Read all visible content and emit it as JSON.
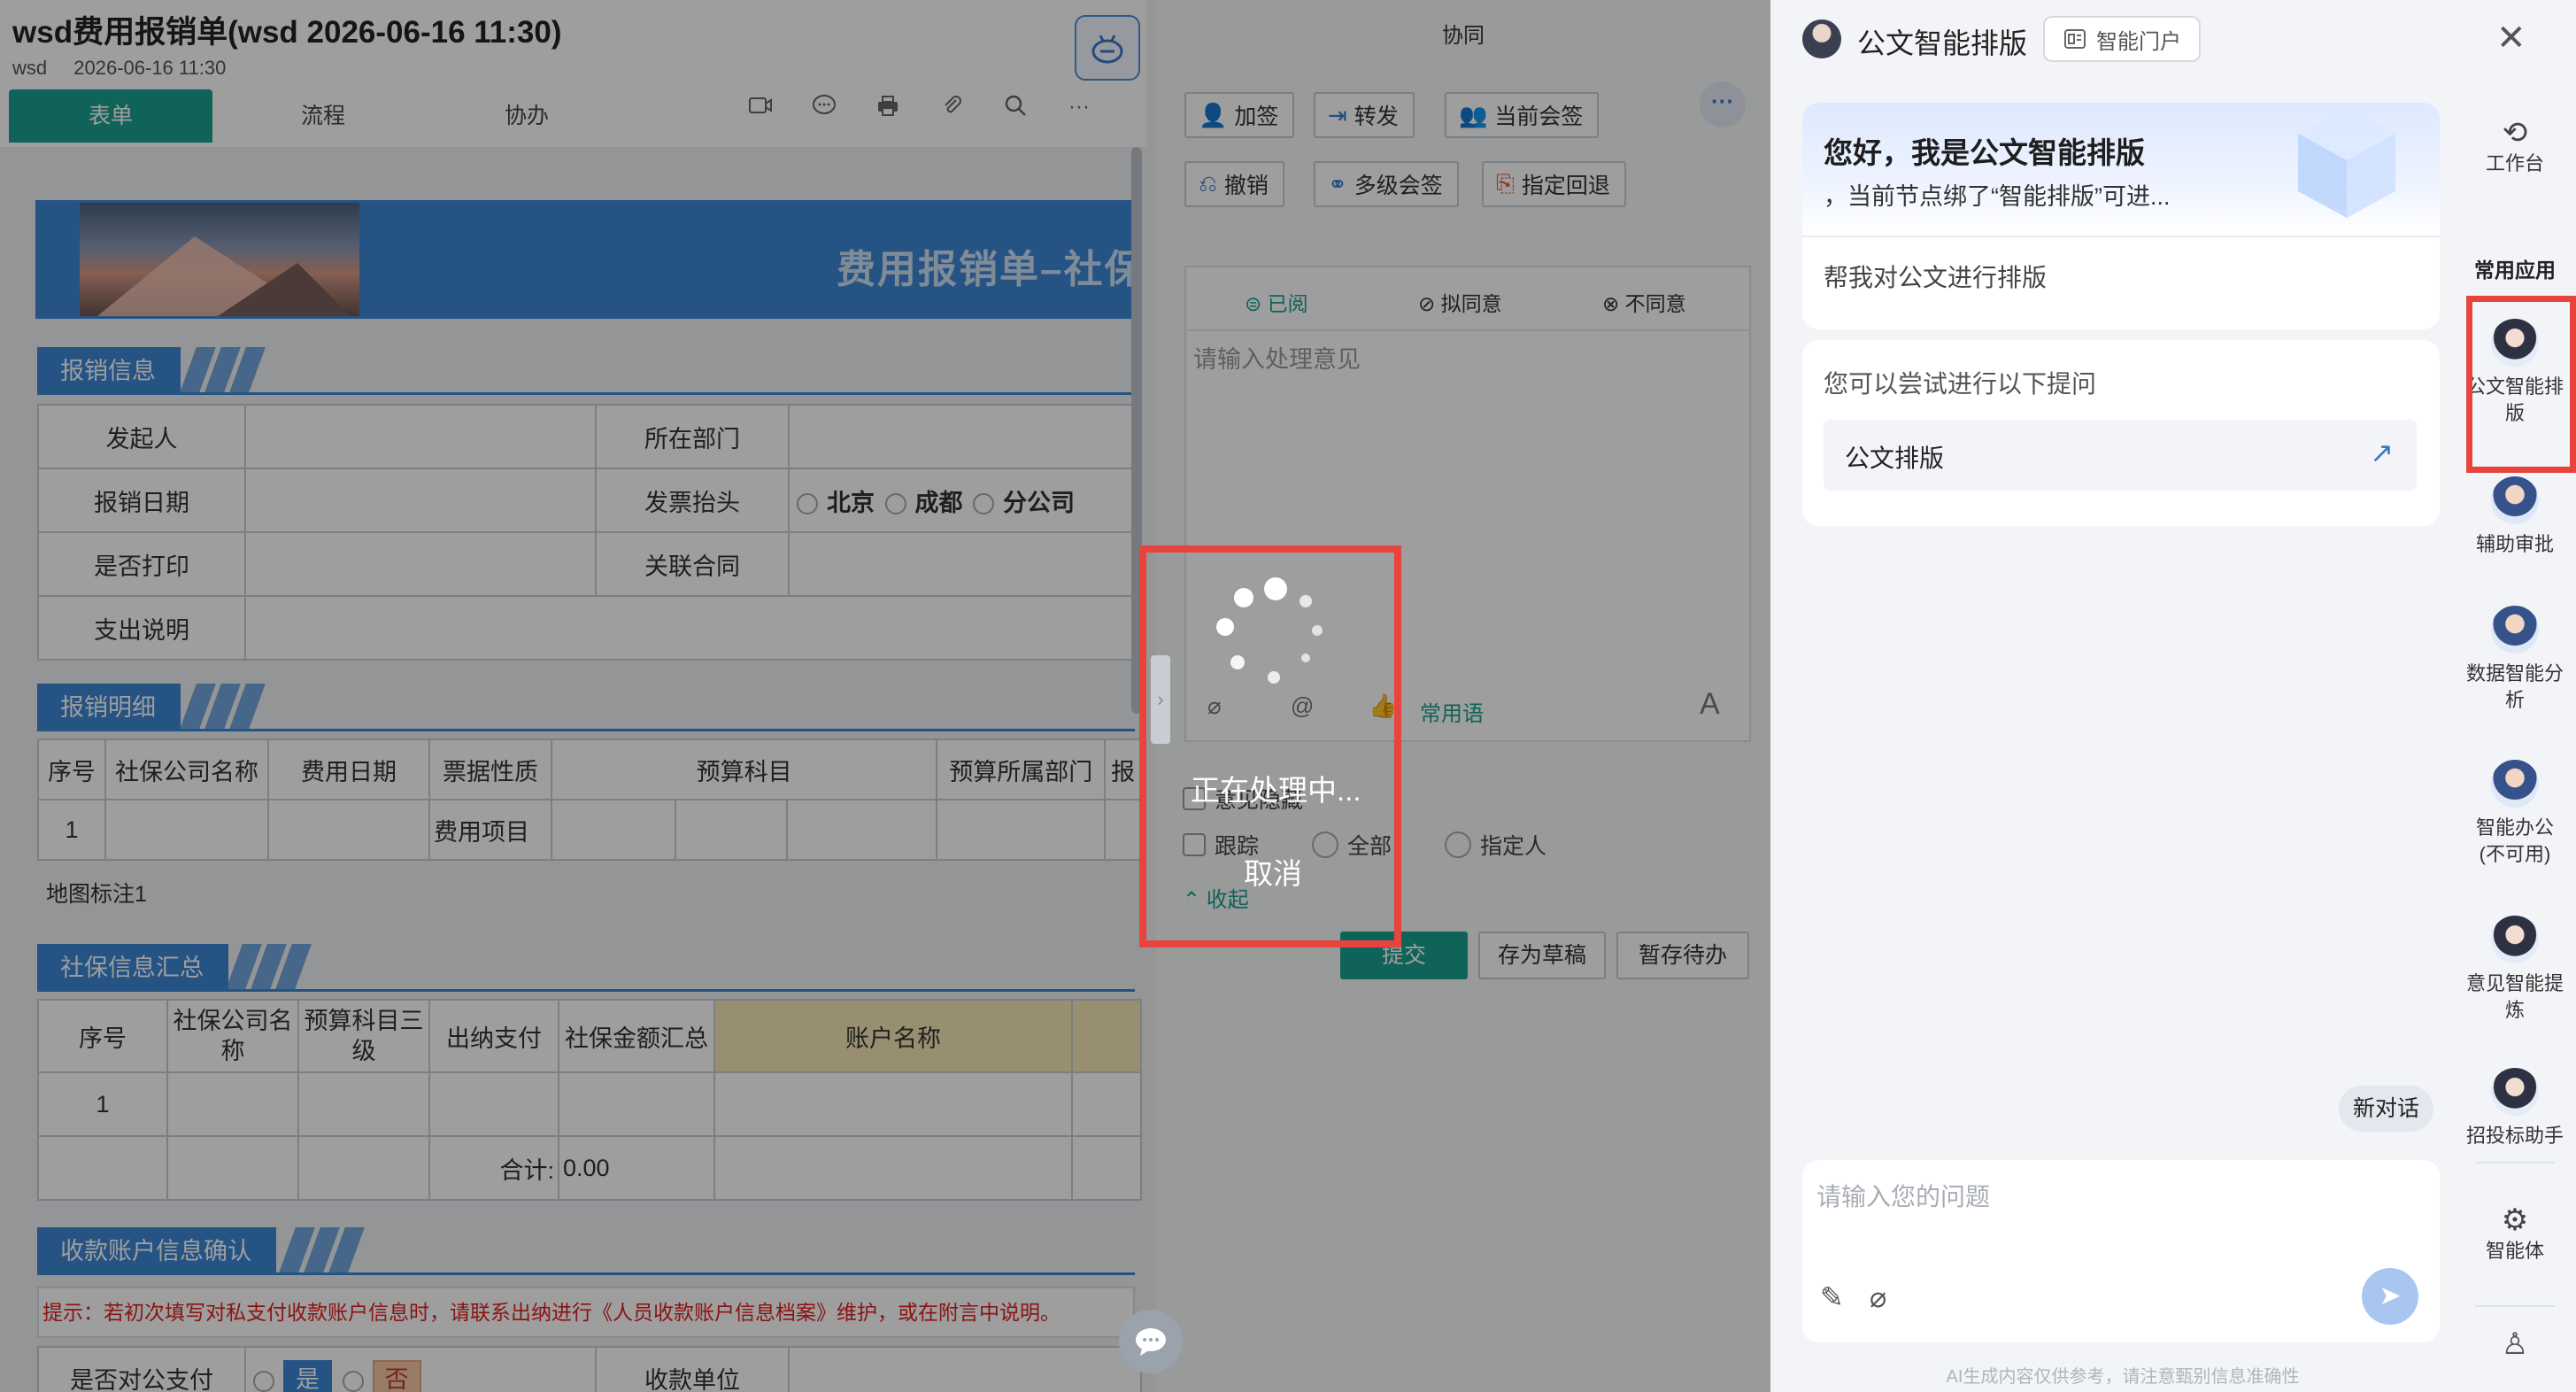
{
  "form": {
    "title": "wsd费用报销单(wsd 2026-06-16 11:30)",
    "meta_user": "wsd",
    "meta_time": "2026-06-16 11:30",
    "tabs": [
      "表单",
      "流程",
      "协办"
    ],
    "tool_icons": [
      "video-icon",
      "comment-icon",
      "print-icon",
      "attach-icon",
      "search-icon",
      "more-icon"
    ],
    "banner_title": "费用报销单–社保",
    "sec1": "报销信息",
    "sec2": "报销明细",
    "sec3": "社保信息汇总",
    "sec4": "收款账户信息确认",
    "info_rows": [
      [
        "发起人",
        "所在部门"
      ],
      [
        "报销日期",
        "发票抬头"
      ],
      [
        "是否打印",
        "关联合同"
      ],
      [
        "支出说明"
      ]
    ],
    "invoice_options": [
      "北京",
      "成都",
      "分公司"
    ],
    "detail_headers": [
      "序号",
      "社保公司名称",
      "费用日期",
      "票据性质",
      "预算科目",
      "预算所属部门",
      "报"
    ],
    "detail_row_no": "1",
    "detail_sub": "费用项目",
    "map_note": "地图标注1",
    "sum_headers": [
      "序号",
      "社保公司名称",
      "预算科目三级",
      "出纳支付",
      "社保金额汇总",
      "账户名称"
    ],
    "sum_row_no": "1",
    "total_label": "合计:",
    "total_value": "0.00",
    "hint": "提示：若初次填写对私支付收款账户信息时，请联系出纳进行《人员收款账户信息档案》维护，或在附言中说明。",
    "public_pay_label": "是否对公支付",
    "yes": "是",
    "no": "否",
    "payee_label": "收款单位"
  },
  "collab": {
    "title": "协同",
    "buttons_row1": [
      "加签",
      "转发",
      "当前会签"
    ],
    "buttons_row2": [
      "撤销",
      "多级会签",
      "指定回退"
    ],
    "opinion_tabs": [
      "已阅",
      "拟同意",
      "不同意"
    ],
    "opinion_placeholder": "请输入处理意见",
    "common_phrases": "常用语",
    "font_btn": "A",
    "hide_opinion": "意见隐藏",
    "track": "跟踪",
    "all": "全部",
    "assignee": "指定人",
    "collapse": "收起",
    "submit": "提交",
    "save_draft": "存为草稿",
    "hold": "暂存待办"
  },
  "loading": {
    "text": "正在处理中...",
    "cancel": "取消"
  },
  "ai": {
    "title": "公文智能排版",
    "portal": "智能门户",
    "greeting": "您好，我是公文智能排版",
    "greeting_sub": "，当前节点绑了“智能排版”可进...",
    "help": "帮我对公文进行排版",
    "suggest_title": "您可以尝试进行以下提问",
    "suggest_item": "公文排版",
    "new_chat": "新对话",
    "input_placeholder": "请输入您的问题",
    "disclaimer": "AI生成内容仅供参考，请注意甄别信息准确性",
    "side": {
      "workbench": "工作台",
      "common_apps": "常用应用",
      "apps": [
        "公文智能排版",
        "辅助审批",
        "数据智能分析",
        "智能办公(不可用)",
        "意见智能提炼",
        "招投标助手"
      ],
      "agent": "智能体"
    }
  },
  "colors": {
    "teal": "#1aa08f",
    "blue": "#3c86d6",
    "highlight_red": "#e8443d"
  }
}
